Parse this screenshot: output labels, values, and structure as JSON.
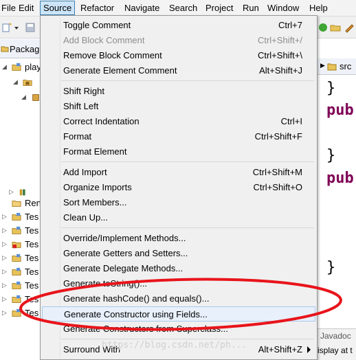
{
  "menubar": {
    "items": [
      "File",
      "Edit",
      "Source",
      "Refactor",
      "Navigate",
      "Search",
      "Project",
      "Run",
      "Window",
      "Help"
    ],
    "active": "Source"
  },
  "explorer": {
    "tab_label": "Packag",
    "rows": [
      {
        "label": "play",
        "icon": "project-icon"
      },
      {
        "label": "",
        "icon": "source-folder-icon"
      },
      {
        "label": "",
        "icon": "package-icon"
      },
      {
        "label": "",
        "icon": "library-icon"
      },
      {
        "label": "Ren",
        "icon": "folder-icon"
      },
      {
        "label": "Tes",
        "icon": "project-icon"
      },
      {
        "label": "Tes",
        "icon": "project-icon"
      },
      {
        "label": "Tes",
        "icon": "project-error-icon"
      },
      {
        "label": "Tes",
        "icon": "project-icon"
      },
      {
        "label": "Tes",
        "icon": "project-icon"
      },
      {
        "label": "Tes",
        "icon": "project-icon"
      },
      {
        "label": "Tes",
        "icon": "project-icon"
      },
      {
        "label": "Tes",
        "icon": "project-icon"
      }
    ]
  },
  "editor": {
    "breadcrumb": "src",
    "code_lines": [
      "}",
      "pub",
      "}",
      "pub",
      "}"
    ]
  },
  "javadoc": {
    "tab_label": "Javadoc",
    "text": "isplay at t"
  },
  "source_menu": {
    "groups": [
      [
        {
          "label": "Toggle Comment",
          "shortcut": "Ctrl+7",
          "enabled": true
        },
        {
          "label": "Add Block Comment",
          "shortcut": "Ctrl+Shift+/",
          "enabled": false
        },
        {
          "label": "Remove Block Comment",
          "shortcut": "Ctrl+Shift+\\",
          "enabled": true
        },
        {
          "label": "Generate Element Comment",
          "shortcut": "Alt+Shift+J",
          "enabled": true
        }
      ],
      [
        {
          "label": "Shift Right",
          "shortcut": "",
          "enabled": true
        },
        {
          "label": "Shift Left",
          "shortcut": "",
          "enabled": true
        },
        {
          "label": "Correct Indentation",
          "shortcut": "Ctrl+I",
          "enabled": true
        },
        {
          "label": "Format",
          "shortcut": "Ctrl+Shift+F",
          "enabled": true
        },
        {
          "label": "Format Element",
          "shortcut": "",
          "enabled": true
        }
      ],
      [
        {
          "label": "Add Import",
          "shortcut": "Ctrl+Shift+M",
          "enabled": true
        },
        {
          "label": "Organize Imports",
          "shortcut": "Ctrl+Shift+O",
          "enabled": true
        },
        {
          "label": "Sort Members...",
          "shortcut": "",
          "enabled": true
        },
        {
          "label": "Clean Up...",
          "shortcut": "",
          "enabled": true
        }
      ],
      [
        {
          "label": "Override/Implement Methods...",
          "shortcut": "",
          "enabled": true
        },
        {
          "label": "Generate Getters and Setters...",
          "shortcut": "",
          "enabled": true
        },
        {
          "label": "Generate Delegate Methods...",
          "shortcut": "",
          "enabled": true
        },
        {
          "label": "Generate toString()...",
          "shortcut": "",
          "enabled": true
        },
        {
          "label": "Generate hashCode() and equals()...",
          "shortcut": "",
          "enabled": true
        },
        {
          "label": "Generate Constructor using Fields...",
          "shortcut": "",
          "enabled": true,
          "highlighted": true
        },
        {
          "label": "Generate Constructors from Superclass...",
          "shortcut": "",
          "enabled": true
        }
      ],
      [
        {
          "label": "Surround With",
          "shortcut": "Alt+Shift+Z",
          "enabled": true,
          "submenu": true
        }
      ]
    ]
  },
  "watermark": "https://blog.csdn.net/ph...",
  "colors": {
    "menu_bg": "#f0f0f0",
    "highlight": "#e8f0fb",
    "annotation": "#e8141b",
    "keyword": "#7f0055"
  }
}
